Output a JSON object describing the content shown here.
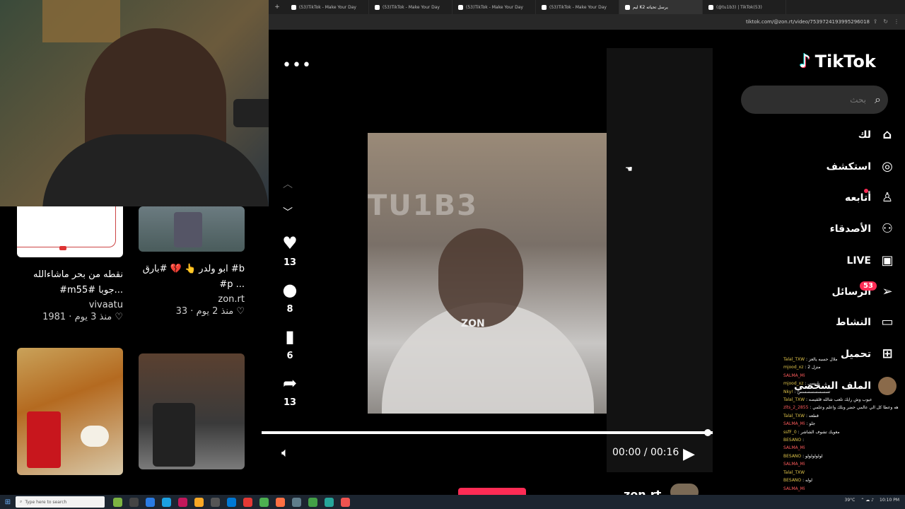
{
  "browser": {
    "tabs": [
      {
        "title": "(53)TikTok - Make Your Day",
        "active": false
      },
      {
        "title": "(53)TikTok - Make Your Day",
        "active": false
      },
      {
        "title": "(53)TikTok - Make Your Day",
        "active": false
      },
      {
        "title": "(53)TikTok - Make Your Day",
        "active": false
      },
      {
        "title": "ليم K2 يرسل تحياته",
        "active": true
      },
      {
        "title": "(@tu1b3) | TikTok(53)",
        "active": false
      }
    ],
    "new_tab": "+",
    "url": "tiktok.com/@zon.rt/video/7539724193995296018"
  },
  "sidebar": {
    "logo": "TikTok",
    "search_placeholder": "بحث",
    "items": [
      {
        "label": "لك",
        "icon": "home-icon",
        "glyph": "⌂"
      },
      {
        "label": "استكشف",
        "icon": "compass-icon",
        "glyph": "◎"
      },
      {
        "label": "أتابعه",
        "icon": "following-icon",
        "glyph": "♙"
      },
      {
        "label": "الأصدقاء",
        "icon": "friends-icon",
        "glyph": "⚇"
      },
      {
        "label": "LIVE",
        "icon": "live-icon",
        "glyph": "▣"
      },
      {
        "label": "الرسائل",
        "icon": "messages-icon",
        "glyph": "➢"
      },
      {
        "label": "النشاط",
        "icon": "activity-icon",
        "glyph": "▭"
      },
      {
        "label": "تحميل",
        "icon": "upload-icon",
        "glyph": "⊞"
      },
      {
        "label": "الملف الشخصي",
        "icon": "profile-icon",
        "glyph": ""
      }
    ],
    "messages_badge": "53"
  },
  "video": {
    "watermark": "TU1B3",
    "overlay_label": "ZON",
    "time": "00:00 / 00:16",
    "progress": 1.0,
    "actions": {
      "likes": "13",
      "comments": "8",
      "saves": "6",
      "shares": "13"
    },
    "author": "zon.rt"
  },
  "grid": {
    "cards": [
      {
        "caption_line1": "نقطه من بحر ماشاءالله",
        "caption_line2": "#m55# جوبا...",
        "author": "vivaatu",
        "likes": "1981",
        "age": "منذ 3 يوم"
      },
      {
        "caption_line1": "ابو ولدر 👆 💔 #بارق #b",
        "caption_line2": "#p ...",
        "author": "zon.rt",
        "likes": "33",
        "age": "منذ 2 يوم"
      }
    ]
  },
  "chat": {
    "lines": [
      {
        "user": "Talal_TXW",
        "text": ": ملال حسبه يالعز"
      },
      {
        "user": "mjood_xz",
        "text": ": 2 منزل"
      },
      {
        "user": "SALMA_Mi",
        "text": ""
      },
      {
        "user": "mjood_xz",
        "text": ": يا بسي"
      },
      {
        "user": "Nky!",
        "text": ": تسسسسسسسس"
      },
      {
        "user": "Talal_TXW",
        "text": ": عيوب وش رايك تلعب شالله قلقيصه"
      },
      {
        "user": "zlts_2_2855",
        "text": ": هه وعطا كل الي عالمي حضر وبلك واعلم وعلمي"
      },
      {
        "user": "Talal_TXW",
        "text": ": قطعه"
      },
      {
        "user": "SALMA_Mi",
        "text": ": جلو"
      },
      {
        "user": "ssfF_0",
        "text": ": مغويك تشوف الشاشر"
      },
      {
        "user": "BESANO",
        "text": ":"
      },
      {
        "user": "SALMA_Mi",
        "text": ""
      },
      {
        "user": "BESANO",
        "text": ": لولولولولو"
      },
      {
        "user": "SALMA_Mi",
        "text": ""
      },
      {
        "user": "Talal_TXW",
        "text": ""
      },
      {
        "user": "BESANO",
        "text": ": لوله"
      },
      {
        "user": "SALMA_Mi",
        "text": ""
      }
    ]
  },
  "taskbar": {
    "search_placeholder": "Type here to search",
    "weather": "39°C",
    "time": "10:10 PM"
  }
}
